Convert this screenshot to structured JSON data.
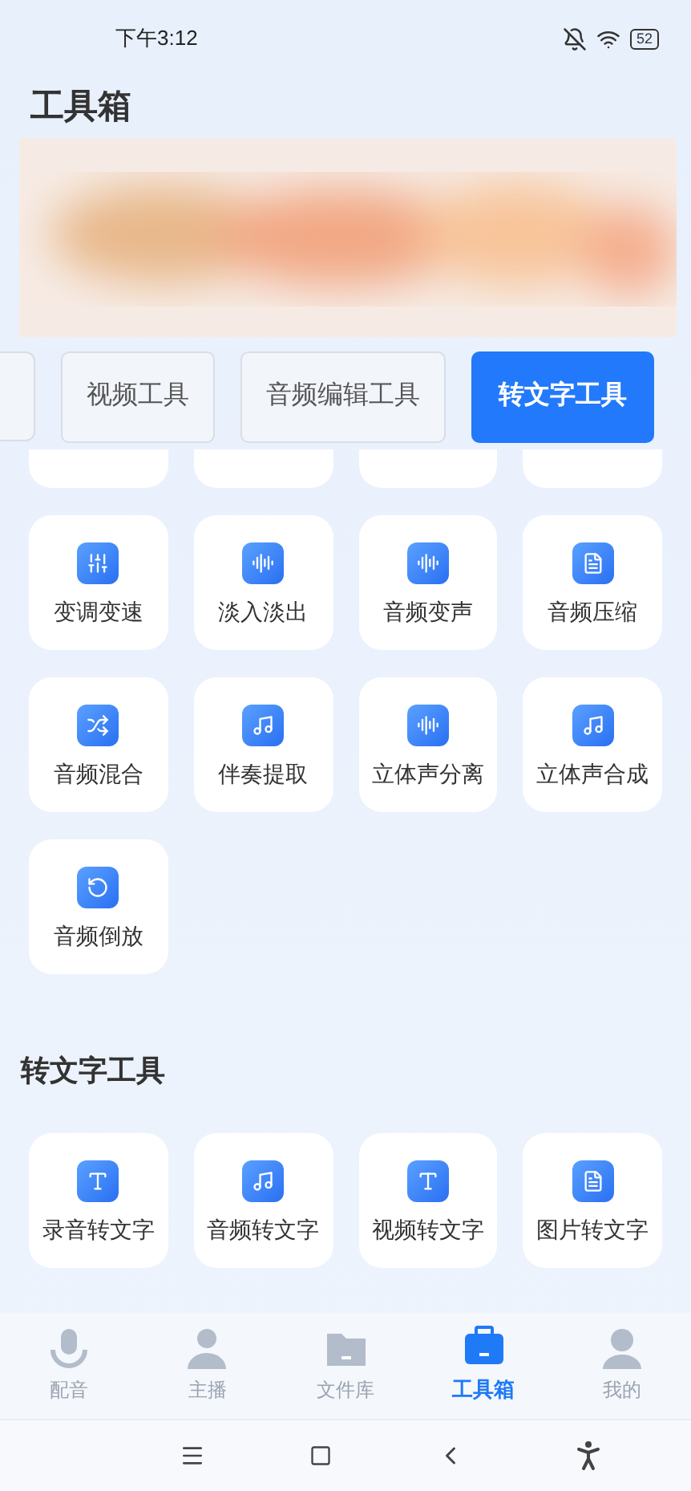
{
  "status_bar": {
    "time": "下午3:12",
    "battery": "52"
  },
  "title": "工具箱",
  "tabs": [
    {
      "label": "视频工具",
      "selected": false
    },
    {
      "label": "音频编辑工具",
      "selected": false
    },
    {
      "label": "转文字工具",
      "selected": true
    }
  ],
  "audio_tools": [
    {
      "label": "变调变速",
      "kind": "sliders"
    },
    {
      "label": "淡入淡出",
      "kind": "fade"
    },
    {
      "label": "音频变声",
      "kind": "wave"
    },
    {
      "label": "音频压缩",
      "kind": "compress"
    },
    {
      "label": "音频混合",
      "kind": "shuffle"
    },
    {
      "label": "伴奏提取",
      "kind": "extract"
    },
    {
      "label": "立体声分离",
      "kind": "stereo"
    },
    {
      "label": "立体声合成",
      "kind": "merge"
    },
    {
      "label": "音频倒放",
      "kind": "reverse"
    }
  ],
  "text_section": {
    "title": "转文字工具",
    "tools": [
      {
        "label": "录音转文字",
        "kind": "record"
      },
      {
        "label": "音频转文字",
        "kind": "audio"
      },
      {
        "label": "视频转文字",
        "kind": "video"
      },
      {
        "label": "图片转文字"
      }
    ]
  },
  "bottom_nav": [
    {
      "label": "配音",
      "kind": "dub",
      "selected": false
    },
    {
      "label": "主播",
      "kind": "anchor",
      "selected": false
    },
    {
      "label": "文件库",
      "kind": "folder",
      "selected": false
    },
    {
      "label": "工具箱",
      "kind": "toolbox",
      "selected": true
    },
    {
      "label": "我的",
      "kind": "me",
      "selected": false
    }
  ]
}
